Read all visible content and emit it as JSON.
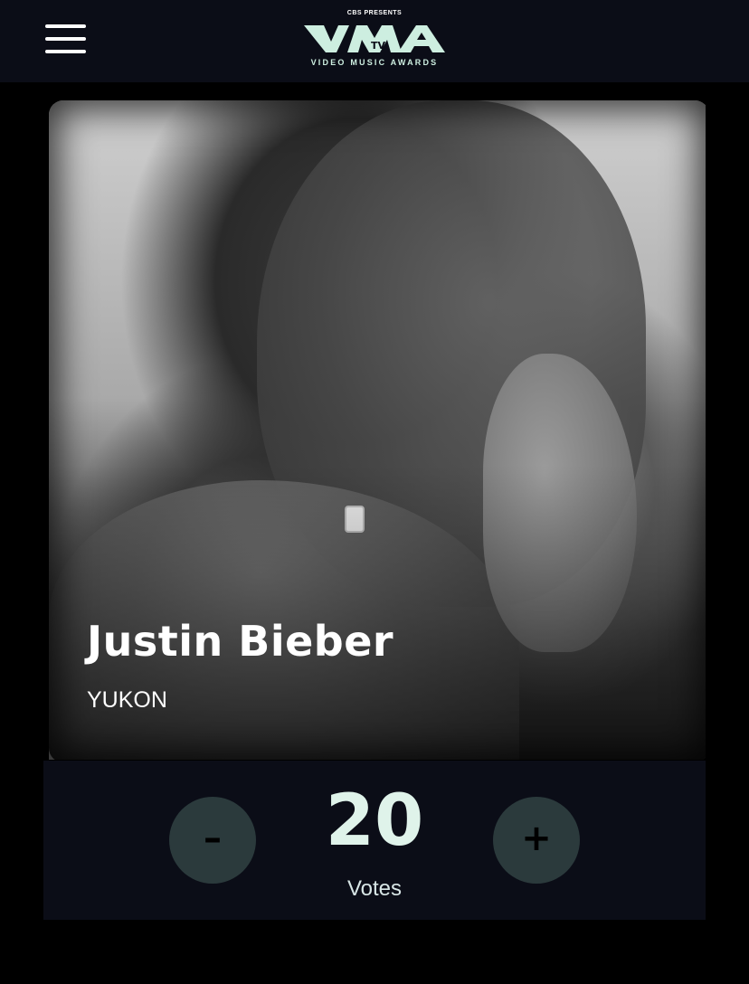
{
  "header": {
    "menu_icon": "hamburger-menu-icon",
    "logo": {
      "presenter": "CBS PRESENTS",
      "mark_text": "VMA",
      "mtv_text": "TV",
      "subtitle": "VIDEO MUSIC AWARDS",
      "color": "#cdeee0"
    },
    "background": "#0b0d17"
  },
  "nominee": {
    "artist": "Justin Bieber",
    "song": "YUKON"
  },
  "voting": {
    "minus_label": "–",
    "plus_label": "+",
    "count": "20",
    "count_label": "Votes",
    "button_color": "#2b3a3c",
    "count_color": "#dff3ea"
  }
}
